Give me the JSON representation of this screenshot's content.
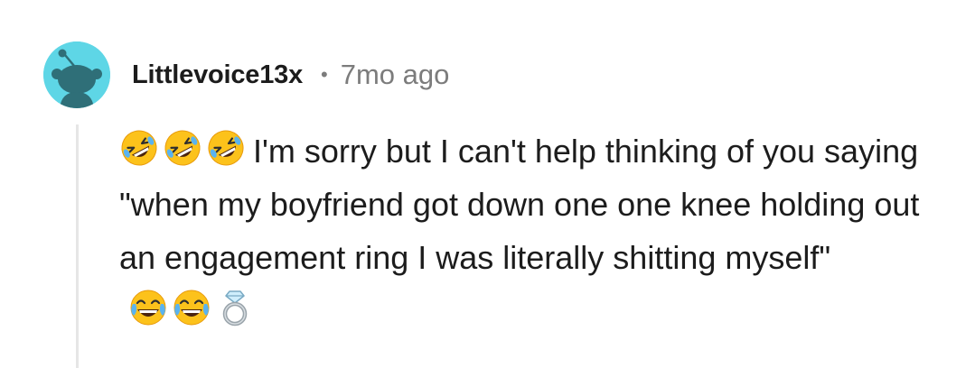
{
  "comment": {
    "author": "Littlevoice13x",
    "separator": "•",
    "time_ago": "7mo ago",
    "leading_emojis": [
      "rolling-on-floor-laughing",
      "rolling-on-floor-laughing",
      "rolling-on-floor-laughing"
    ],
    "text": "I'm sorry but I can't help thinking of you saying \"when my boyfriend got down one one knee holding out an engagement ring I was literally shitting myself\"",
    "trailing_emojis": [
      "face-with-tears-of-joy",
      "face-with-tears-of-joy",
      "ring"
    ]
  },
  "colors": {
    "avatar_bg": "#5ed6e6",
    "username": "#1c1c1c",
    "meta_gray": "#7c7c7c",
    "thread_line": "#e6e6e6"
  },
  "icons": {
    "avatar": "reddit-snoo-icon"
  }
}
